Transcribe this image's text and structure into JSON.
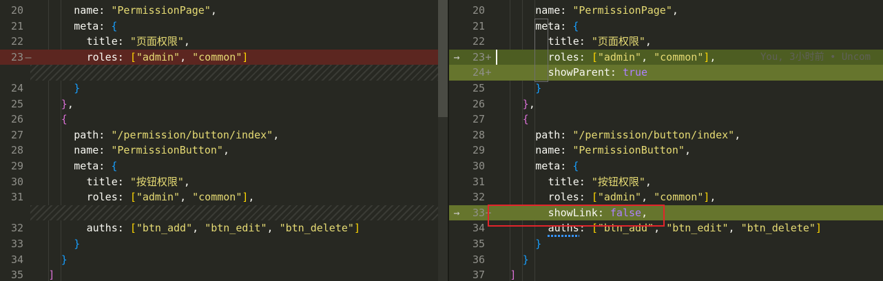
{
  "left": {
    "lines": [
      {
        "num": "20",
        "mark": "",
        "indent": 3,
        "tokens": [
          [
            "k",
            "name: "
          ],
          [
            "s",
            "\"PermissionPage\""
          ],
          [
            "p",
            ","
          ]
        ]
      },
      {
        "num": "21",
        "mark": "",
        "indent": 3,
        "tokens": [
          [
            "k",
            "meta: "
          ],
          [
            "b3",
            "{"
          ]
        ]
      },
      {
        "num": "22",
        "mark": "",
        "indent": 4,
        "tokens": [
          [
            "k",
            "title: "
          ],
          [
            "s",
            "\"页面权限\""
          ],
          [
            "p",
            ","
          ]
        ]
      },
      {
        "num": "23",
        "mark": "—",
        "indent": 4,
        "tokens": [
          [
            "k",
            "roles: "
          ],
          [
            "b1",
            "["
          ],
          [
            "s",
            "\"admin\""
          ],
          [
            "p",
            ", "
          ],
          [
            "s",
            "\"common\""
          ],
          [
            "b1",
            "]"
          ]
        ]
      },
      {
        "num": "24",
        "mark": "",
        "indent": 3,
        "tokens": [
          [
            "b3",
            "}"
          ]
        ]
      },
      {
        "num": "25",
        "mark": "",
        "indent": 2,
        "tokens": [
          [
            "b2",
            "}"
          ],
          [
            "p",
            ","
          ]
        ]
      },
      {
        "num": "26",
        "mark": "",
        "indent": 2,
        "tokens": [
          [
            "b2",
            "{"
          ]
        ]
      },
      {
        "num": "27",
        "mark": "",
        "indent": 3,
        "tokens": [
          [
            "k",
            "path: "
          ],
          [
            "s",
            "\"/permission/button/index\""
          ],
          [
            "p",
            ","
          ]
        ]
      },
      {
        "num": "28",
        "mark": "",
        "indent": 3,
        "tokens": [
          [
            "k",
            "name: "
          ],
          [
            "s",
            "\"PermissionButton\""
          ],
          [
            "p",
            ","
          ]
        ]
      },
      {
        "num": "29",
        "mark": "",
        "indent": 3,
        "tokens": [
          [
            "k",
            "meta: "
          ],
          [
            "b3",
            "{"
          ]
        ]
      },
      {
        "num": "30",
        "mark": "",
        "indent": 4,
        "tokens": [
          [
            "k",
            "title: "
          ],
          [
            "s",
            "\"按钮权限\""
          ],
          [
            "p",
            ","
          ]
        ]
      },
      {
        "num": "31",
        "mark": "",
        "indent": 4,
        "tokens": [
          [
            "k",
            "roles: "
          ],
          [
            "b1",
            "["
          ],
          [
            "s",
            "\"admin\""
          ],
          [
            "p",
            ", "
          ],
          [
            "s",
            "\"common\""
          ],
          [
            "b1",
            "]"
          ],
          [
            "p",
            ","
          ]
        ]
      },
      {
        "num": "32",
        "mark": "",
        "indent": 4,
        "tokens": [
          [
            "k",
            "auths: "
          ],
          [
            "b1",
            "["
          ],
          [
            "s",
            "\"btn_add\""
          ],
          [
            "p",
            ", "
          ],
          [
            "s",
            "\"btn_edit\""
          ],
          [
            "p",
            ", "
          ],
          [
            "s",
            "\"btn_delete\""
          ],
          [
            "b1",
            "]"
          ]
        ]
      },
      {
        "num": "33",
        "mark": "",
        "indent": 3,
        "tokens": [
          [
            "b3",
            "}"
          ]
        ]
      },
      {
        "num": "34",
        "mark": "",
        "indent": 2,
        "tokens": [
          [
            "b3",
            "}"
          ]
        ]
      },
      {
        "num": "35",
        "mark": "",
        "indent": 1,
        "tokens": [
          [
            "b2",
            "]"
          ]
        ]
      }
    ]
  },
  "right": {
    "lines": [
      {
        "num": "20",
        "mark": "",
        "arrow": "",
        "indent": 3,
        "tokens": [
          [
            "k",
            "name: "
          ],
          [
            "s",
            "\"PermissionPage\""
          ],
          [
            "p",
            ","
          ]
        ]
      },
      {
        "num": "21",
        "mark": "",
        "arrow": "",
        "indent": 3,
        "tokens": [
          [
            "k",
            "meta: "
          ],
          [
            "b3",
            "{"
          ]
        ]
      },
      {
        "num": "22",
        "mark": "",
        "arrow": "",
        "indent": 4,
        "tokens": [
          [
            "k",
            "title: "
          ],
          [
            "s",
            "\"页面权限\""
          ],
          [
            "p",
            ","
          ]
        ]
      },
      {
        "num": "23",
        "mark": "+",
        "arrow": "→",
        "indent": 4,
        "tokens": [
          [
            "k",
            "roles: "
          ],
          [
            "b1",
            "["
          ],
          [
            "s",
            "\"admin\""
          ],
          [
            "p",
            ", "
          ],
          [
            "s",
            "\"common\""
          ],
          [
            "b1",
            "]"
          ],
          [
            "p",
            ","
          ]
        ]
      },
      {
        "num": "24",
        "mark": "+",
        "arrow": "",
        "indent": 4,
        "tokens": [
          [
            "k",
            "showParent: "
          ],
          [
            "kw",
            "true"
          ]
        ]
      },
      {
        "num": "25",
        "mark": "",
        "arrow": "",
        "indent": 3,
        "tokens": [
          [
            "b3",
            "}"
          ]
        ]
      },
      {
        "num": "26",
        "mark": "",
        "arrow": "",
        "indent": 2,
        "tokens": [
          [
            "b2",
            "}"
          ],
          [
            "p",
            ","
          ]
        ]
      },
      {
        "num": "27",
        "mark": "",
        "arrow": "",
        "indent": 2,
        "tokens": [
          [
            "b2",
            "{"
          ]
        ]
      },
      {
        "num": "28",
        "mark": "",
        "arrow": "",
        "indent": 3,
        "tokens": [
          [
            "k",
            "path: "
          ],
          [
            "s",
            "\"/permission/button/index\""
          ],
          [
            "p",
            ","
          ]
        ]
      },
      {
        "num": "29",
        "mark": "",
        "arrow": "",
        "indent": 3,
        "tokens": [
          [
            "k",
            "name: "
          ],
          [
            "s",
            "\"PermissionButton\""
          ],
          [
            "p",
            ","
          ]
        ]
      },
      {
        "num": "30",
        "mark": "",
        "arrow": "",
        "indent": 3,
        "tokens": [
          [
            "k",
            "meta: "
          ],
          [
            "b3",
            "{"
          ]
        ]
      },
      {
        "num": "31",
        "mark": "",
        "arrow": "",
        "indent": 4,
        "tokens": [
          [
            "k",
            "title: "
          ],
          [
            "s",
            "\"按钮权限\""
          ],
          [
            "p",
            ","
          ]
        ]
      },
      {
        "num": "32",
        "mark": "",
        "arrow": "",
        "indent": 4,
        "tokens": [
          [
            "k",
            "roles: "
          ],
          [
            "b1",
            "["
          ],
          [
            "s",
            "\"admin\""
          ],
          [
            "p",
            ", "
          ],
          [
            "s",
            "\"common\""
          ],
          [
            "b1",
            "]"
          ],
          [
            "p",
            ","
          ]
        ]
      },
      {
        "num": "33",
        "mark": "+",
        "arrow": "→",
        "indent": 4,
        "tokens": [
          [
            "k",
            "showLink: "
          ],
          [
            "kw",
            "false"
          ],
          [
            "p",
            ","
          ]
        ]
      },
      {
        "num": "34",
        "mark": "",
        "arrow": "",
        "indent": 4,
        "tokens": [
          [
            "k",
            "auths: "
          ],
          [
            "b1",
            "["
          ],
          [
            "s",
            "\"btn_add\""
          ],
          [
            "p",
            ", "
          ],
          [
            "s",
            "\"btn_edit\""
          ],
          [
            "p",
            ", "
          ],
          [
            "s",
            "\"btn_delete\""
          ],
          [
            "b1",
            "]"
          ]
        ]
      },
      {
        "num": "35",
        "mark": "",
        "arrow": "",
        "indent": 3,
        "tokens": [
          [
            "b3",
            "}"
          ]
        ]
      },
      {
        "num": "36",
        "mark": "",
        "arrow": "",
        "indent": 2,
        "tokens": [
          [
            "b3",
            "}"
          ]
        ]
      },
      {
        "num": "37",
        "mark": "",
        "arrow": "",
        "indent": 1,
        "tokens": [
          [
            "b2",
            "]"
          ]
        ]
      }
    ]
  },
  "blame": "You, 3小时前 • Uncom",
  "colors": {
    "removed": "#5c2620",
    "added": "#4d5d22",
    "callout": "#e3242b"
  }
}
